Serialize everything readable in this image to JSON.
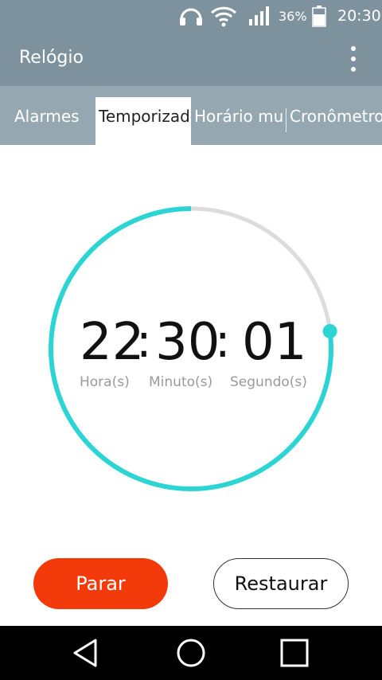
{
  "status_bar": {
    "battery": "36%",
    "time": "20:30",
    "icons": [
      "headset-icon",
      "wifi-icon",
      "signal-icon",
      "battery-icon"
    ]
  },
  "app_bar": {
    "title": "Relógio",
    "menu_icon": "overflow-menu-icon"
  },
  "tabs": [
    {
      "label": "Alarmes",
      "active": false
    },
    {
      "label": "Temporizador",
      "active": true
    },
    {
      "label": "Horário mundial",
      "active": false
    },
    {
      "label": "Cronômetro",
      "active": false
    }
  ],
  "timer": {
    "hours": "22",
    "minutes": "30",
    "seconds": "01",
    "separator": ":",
    "hours_label": "Hora(s)",
    "minutes_label": "Minuto(s)",
    "seconds_label": "Segundo(s)",
    "progress_fraction": 0.77,
    "progress_color": "#2dd4d4",
    "track_color": "#dcdcdc"
  },
  "actions": {
    "stop_label": "Parar",
    "reset_label": "Restaurar",
    "stop_color": "#f23a0a"
  },
  "nav_bar": {
    "icons": [
      "back-icon",
      "home-icon",
      "recents-icon"
    ]
  }
}
